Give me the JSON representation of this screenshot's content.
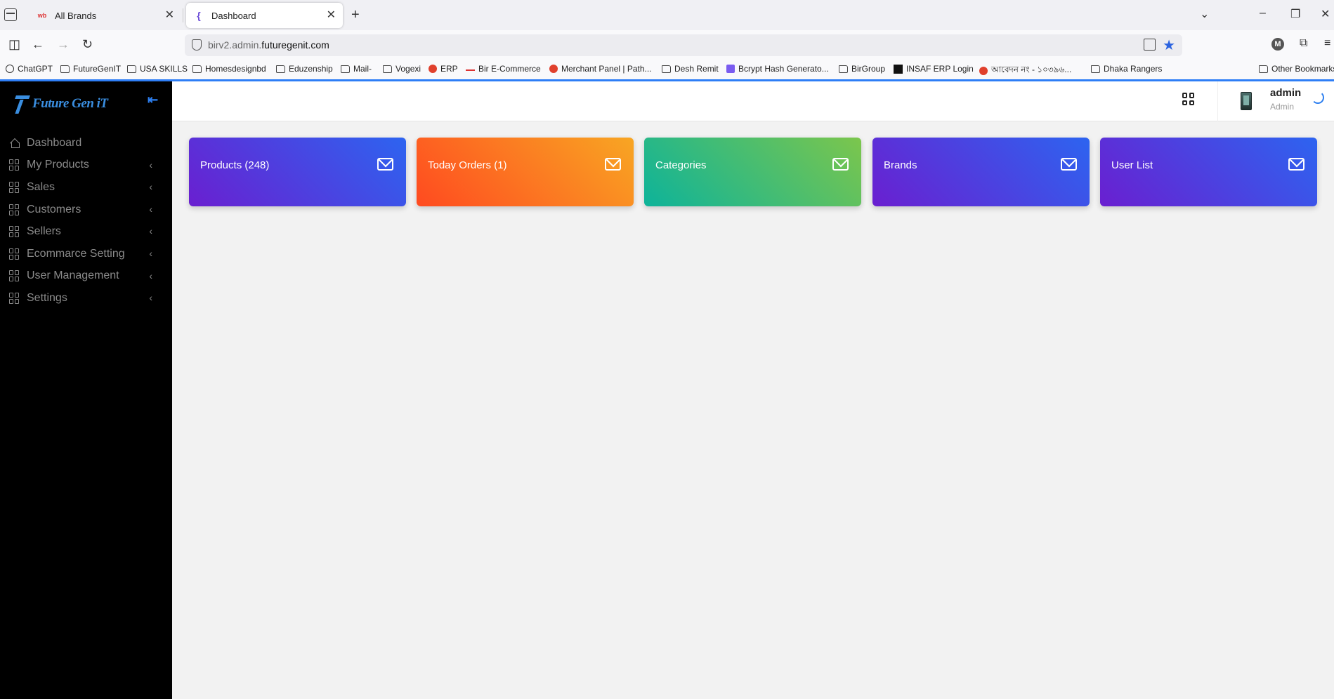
{
  "browser": {
    "tabs": [
      {
        "title": "All Brands",
        "favicon": "wb-brand-icon"
      },
      {
        "title": "Dashboard",
        "favicon": "curly-brace-icon"
      }
    ],
    "url_prefix": "birv2.admin.",
    "url_domain": "futuregenit.com",
    "profile_initial": "M",
    "bookmarks": [
      {
        "label": "ChatGPT",
        "icon": "chatgpt-icon"
      },
      {
        "label": "FutureGenIT",
        "icon": "folder-icon"
      },
      {
        "label": "USA SKILLS",
        "icon": "folder-icon"
      },
      {
        "label": "Homesdesignbd",
        "icon": "folder-icon"
      },
      {
        "label": "Eduzenship",
        "icon": "folder-icon"
      },
      {
        "label": "Mail-",
        "icon": "folder-icon"
      },
      {
        "label": "Vogexi",
        "icon": "folder-icon"
      },
      {
        "label": "ERP",
        "icon": "erp-icon"
      },
      {
        "label": "Bir E-Commerce",
        "icon": "bir-icon"
      },
      {
        "label": "Merchant Panel | Path...",
        "icon": "pathao-icon"
      },
      {
        "label": "Desh Remit",
        "icon": "folder-icon"
      },
      {
        "label": "Bcrypt Hash Generato...",
        "icon": "bcrypt-icon"
      },
      {
        "label": "BirGroup",
        "icon": "folder-icon"
      },
      {
        "label": "INSAF ERP Login",
        "icon": "insaf-icon"
      },
      {
        "label": "আবেদন নং - ১০৩৯৬...",
        "icon": "gov-icon"
      },
      {
        "label": "Dhaka Rangers",
        "icon": "folder-icon"
      },
      {
        "label": "Other Bookmarks",
        "icon": "folder-icon"
      }
    ]
  },
  "app": {
    "brand": "Future Gen iT",
    "sidebar": {
      "items": [
        {
          "label": "Dashboard"
        },
        {
          "label": "My Products"
        },
        {
          "label": "Sales"
        },
        {
          "label": "Customers"
        },
        {
          "label": "Sellers"
        },
        {
          "label": "Ecommarce Setting"
        },
        {
          "label": "User Management"
        },
        {
          "label": "Settings"
        }
      ]
    },
    "header": {
      "user_name": "admin",
      "user_role": "Admin"
    },
    "cards": [
      {
        "title": "Products (248)",
        "icon": "mail-icon"
      },
      {
        "title": "Today Orders (1)",
        "icon": "mail-icon"
      },
      {
        "title": "Categories",
        "icon": "mail-icon"
      },
      {
        "title": "Brands",
        "icon": "mail-icon"
      },
      {
        "title": "User List",
        "icon": "mail-icon"
      }
    ],
    "colors": {
      "sidebar_bg": "#000000",
      "accent": "#2d7ff0",
      "card_purple_blue": [
        "#6a1fd0",
        "#2d64f0"
      ],
      "card_orange": [
        "#ff4a20",
        "#f8a623"
      ],
      "card_green": [
        "#0db39a",
        "#7cc64c"
      ]
    }
  }
}
